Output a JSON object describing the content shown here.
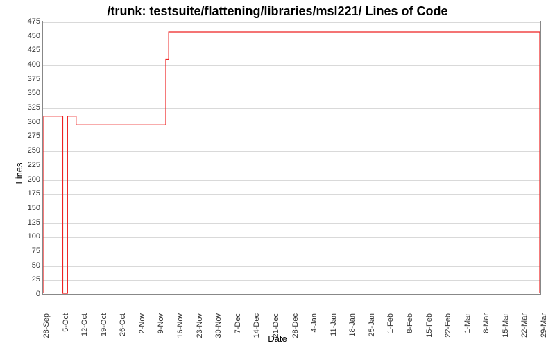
{
  "chart_data": {
    "type": "line",
    "title": "/trunk: testsuite/flattening/libraries/msl221/ Lines of Code",
    "xlabel": "Date",
    "ylabel": "Lines",
    "ylim": [
      0,
      475
    ],
    "yticks": [
      0,
      25,
      50,
      75,
      100,
      125,
      150,
      175,
      200,
      225,
      250,
      275,
      300,
      325,
      350,
      375,
      400,
      425,
      450,
      475
    ],
    "xticks": [
      "28-Sep",
      "5-Oct",
      "12-Oct",
      "19-Oct",
      "26-Oct",
      "2-Nov",
      "9-Nov",
      "16-Nov",
      "23-Nov",
      "30-Nov",
      "7-Dec",
      "14-Dec",
      "21-Dec",
      "28-Dec",
      "4-Jan",
      "11-Jan",
      "18-Jan",
      "25-Jan",
      "1-Feb",
      "8-Feb",
      "15-Feb",
      "22-Feb",
      "1-Mar",
      "8-Mar",
      "15-Mar",
      "22-Mar",
      "29-Mar"
    ],
    "x": [
      0,
      1,
      2,
      3,
      4,
      5,
      6,
      7,
      8,
      9,
      10,
      11,
      12,
      13,
      14,
      15,
      16,
      17,
      18,
      19,
      20,
      21,
      22,
      23,
      24,
      25,
      26
    ],
    "values": [
      {
        "x": 0.0,
        "y": 0
      },
      {
        "x": 0.0,
        "y": 310
      },
      {
        "x": 1.0,
        "y": 310
      },
      {
        "x": 1.0,
        "y": 0
      },
      {
        "x": 1.25,
        "y": 0
      },
      {
        "x": 1.25,
        "y": 310
      },
      {
        "x": 1.7,
        "y": 310
      },
      {
        "x": 1.7,
        "y": 295
      },
      {
        "x": 6.4,
        "y": 295
      },
      {
        "x": 6.4,
        "y": 410
      },
      {
        "x": 6.55,
        "y": 410
      },
      {
        "x": 6.55,
        "y": 458
      },
      {
        "x": 26.0,
        "y": 458
      },
      {
        "x": 26.0,
        "y": 0
      }
    ]
  }
}
